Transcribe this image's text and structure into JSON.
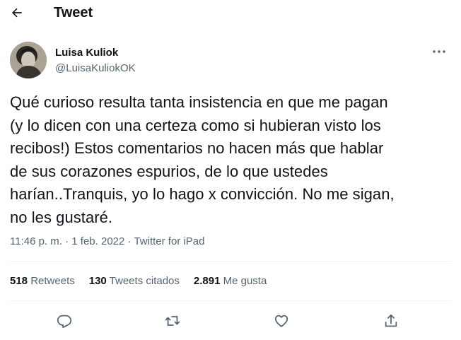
{
  "header": {
    "title": "Tweet"
  },
  "tweet": {
    "author_name": "Luisa Kuliok",
    "author_handle": "@LuisaKuliokOK",
    "text": "Qué curioso resulta tanta insistencia en que me pagan\n(y lo dicen con una certeza como si hubieran visto los\nrecibos!) Estos comentarios no hacen más que hablar\nde sus corazones espurios, de  lo que ustedes\nharían..Tranquis, yo lo hago x convicción. No me sigan,\nno les gustaré.",
    "time": "11:46 p. m.",
    "date": "1 feb. 2022",
    "source": "Twitter for iPad",
    "separator": "·"
  },
  "stats": {
    "retweets_count": "518",
    "retweets_label": "Retweets",
    "quotes_count": "130",
    "quotes_label": "Tweets citados",
    "likes_count": "2.891",
    "likes_label": "Me gusta"
  },
  "icons": {
    "back": "arrow-left-icon",
    "more": "more-horizontal-icon",
    "reply": "reply-icon",
    "retweet": "retweet-icon",
    "like": "heart-icon",
    "share": "share-icon"
  },
  "colors": {
    "text": "#0f1419",
    "secondary": "#536471",
    "divider": "#eff3f4"
  }
}
